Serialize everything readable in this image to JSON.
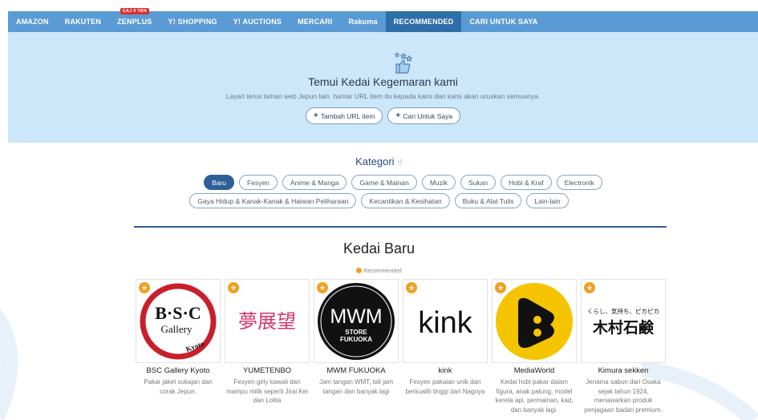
{
  "nav": {
    "items": [
      {
        "label": "AMAZON"
      },
      {
        "label": "RAKUTEN"
      },
      {
        "label": "ZENPLUS",
        "badge": "CAJ 0 YEN"
      },
      {
        "label": "Y! SHOPPING"
      },
      {
        "label": "Y! AUCTIONS"
      },
      {
        "label": "MERCARI"
      },
      {
        "label": "Rakuma"
      },
      {
        "label": "RECOMMENDED",
        "active": true
      },
      {
        "label": "CARI UNTUK SAYA"
      }
    ]
  },
  "hero": {
    "icon": "thumbs-up-stars-icon",
    "title": "Temui Kedai Kegemaran kami",
    "subtitle": "Layari terus laman web Jepun lain. hantar URL item itu kepada kami dan kami akan uruskan semuanya.",
    "add_url_label": "Tambah URL item",
    "search_for_me_label": "Cari Untuk Saya"
  },
  "kategori": {
    "title": "Kategori",
    "row1": [
      "Baru",
      "Fesyen",
      "Anime & Manga",
      "Game & Mainan",
      "Muzik",
      "Sukan",
      "Hobi & Kraf",
      "Electronik"
    ],
    "row2": [
      "Gaya Hidup & Kanak-Kanak & Haiwan Peliharaan",
      "Kecantikan & Kesihatan",
      "Buku & Alat Tulis",
      "Lain-lain"
    ],
    "active": "Baru"
  },
  "shops": {
    "title": "Kedai Baru",
    "recommended_note": "Recommended",
    "items": [
      {
        "name": "BSC Gallery Kyoto",
        "desc": "Pakar jaket sukajan dan corak Jepun.",
        "logo": {
          "type": "bsc",
          "main": "B·S·C",
          "sub": "Gallery",
          "tag": "Kyoto"
        }
      },
      {
        "name": "YUMETENBO",
        "desc": "Fesyen girly kawaii dan mampu milik seperti Jirai Kei dan Lolita",
        "logo": {
          "type": "yume",
          "text": "夢展望"
        }
      },
      {
        "name": "MWM FUKUOKA",
        "desc": "Jam tangan WMT, tali jam tangan dan banyak lagi",
        "logo": {
          "type": "mwm",
          "main": "MWM",
          "sub1": "STORE",
          "sub2": "FUKUOKA"
        }
      },
      {
        "name": "kink",
        "desc": "Fesyen pakaian unik dan berkualiti tinggi dari Nagoya",
        "logo": {
          "type": "kink",
          "text": "kink"
        }
      },
      {
        "name": "MediaWorld",
        "desc": "Kedai hobi pakar dalam figura, anak patung, model kereta api, permainan, kad, dan banyak lagi.",
        "logo": {
          "type": "media"
        }
      },
      {
        "name": "Kimura sekken",
        "desc": "Jenama sabun dari Osaka sejak tahun 1924, menawarkan produk penjagaan badan premium.",
        "logo": {
          "type": "kimura",
          "top": "くらし、気持ち、ピカピカ",
          "main": "木村石鹸"
        }
      }
    ]
  }
}
